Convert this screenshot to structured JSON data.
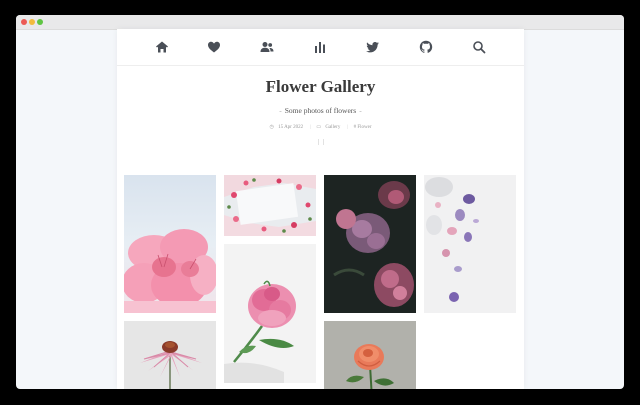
{
  "window": {
    "controls": [
      "close",
      "minimize",
      "maximize"
    ]
  },
  "nav": {
    "items": [
      {
        "name": "home-icon",
        "icon": "home"
      },
      {
        "name": "heart-icon",
        "icon": "heart"
      },
      {
        "name": "users-icon",
        "icon": "users"
      },
      {
        "name": "bar-chart-icon",
        "icon": "bar-chart"
      },
      {
        "name": "twitter-icon",
        "icon": "twitter"
      },
      {
        "name": "github-icon",
        "icon": "github"
      },
      {
        "name": "search-icon",
        "icon": "search"
      }
    ],
    "theme_toggle": "moon-icon"
  },
  "post": {
    "title": "Flower Gallery",
    "subtitle": "Some photos of flowers",
    "date": "15 Apr 2022",
    "category": "Gallery",
    "tag": "# Flower"
  },
  "gallery": {
    "photos": [
      {
        "name": "photo-pink-rhododendron",
        "subject": "pink rhododendron against sky"
      },
      {
        "name": "photo-pink-petals-frame",
        "subject": "pink petals on white"
      },
      {
        "name": "photo-dark-hydrangea",
        "subject": "pink hydrangea on dark background"
      },
      {
        "name": "photo-purple-petals",
        "subject": "purple petals on white"
      },
      {
        "name": "photo-pink-peony",
        "subject": "pink peony"
      },
      {
        "name": "photo-echinacea",
        "subject": "pink coneflower"
      },
      {
        "name": "photo-orange-rose",
        "subject": "orange rose on grey"
      }
    ]
  },
  "colors": {
    "title": "#3a3a3a",
    "nav_icon": "#4a4f57",
    "page_bg": "#ffffff",
    "window_bg": "#f4f7fa"
  }
}
